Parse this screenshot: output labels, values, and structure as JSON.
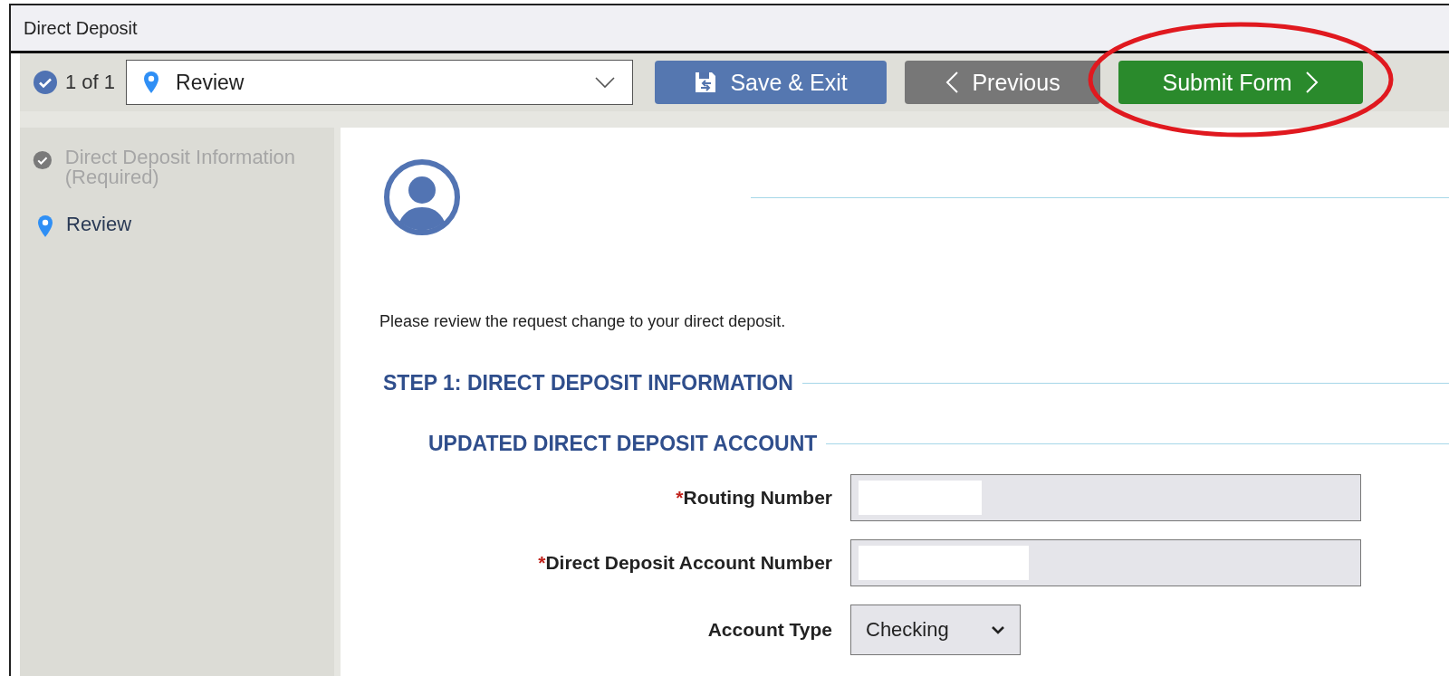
{
  "window": {
    "title": "Direct Deposit"
  },
  "toolbar": {
    "progress": "1 of 1",
    "step_select": {
      "value": "Review"
    },
    "buttons": [
      {
        "kind": "save",
        "label": "Save & Exit"
      },
      {
        "kind": "previous",
        "label": "Previous"
      },
      {
        "kind": "submit",
        "label": "Submit Form",
        "highlighted": true
      }
    ]
  },
  "sidebar": {
    "items": [
      {
        "label": "Direct Deposit Information (Required)",
        "kind": "done",
        "selected": false
      },
      {
        "label": "Review",
        "kind": "current",
        "selected": true
      }
    ]
  },
  "content": {
    "intro": "Please review the request change to your direct deposit.",
    "step_heading": "STEP 1: DIRECT DEPOSIT INFORMATION",
    "section_heading": "UPDATED DIRECT DEPOSIT ACCOUNT",
    "fields": [
      {
        "kind": "text",
        "required_mark": "*",
        "label": "Routing Number",
        "redacted": true
      },
      {
        "kind": "text",
        "required_mark": "*",
        "label": "Direct Deposit Account Number",
        "redacted": true
      },
      {
        "kind": "select",
        "label": "Account Type",
        "value": "Checking"
      }
    ]
  }
}
